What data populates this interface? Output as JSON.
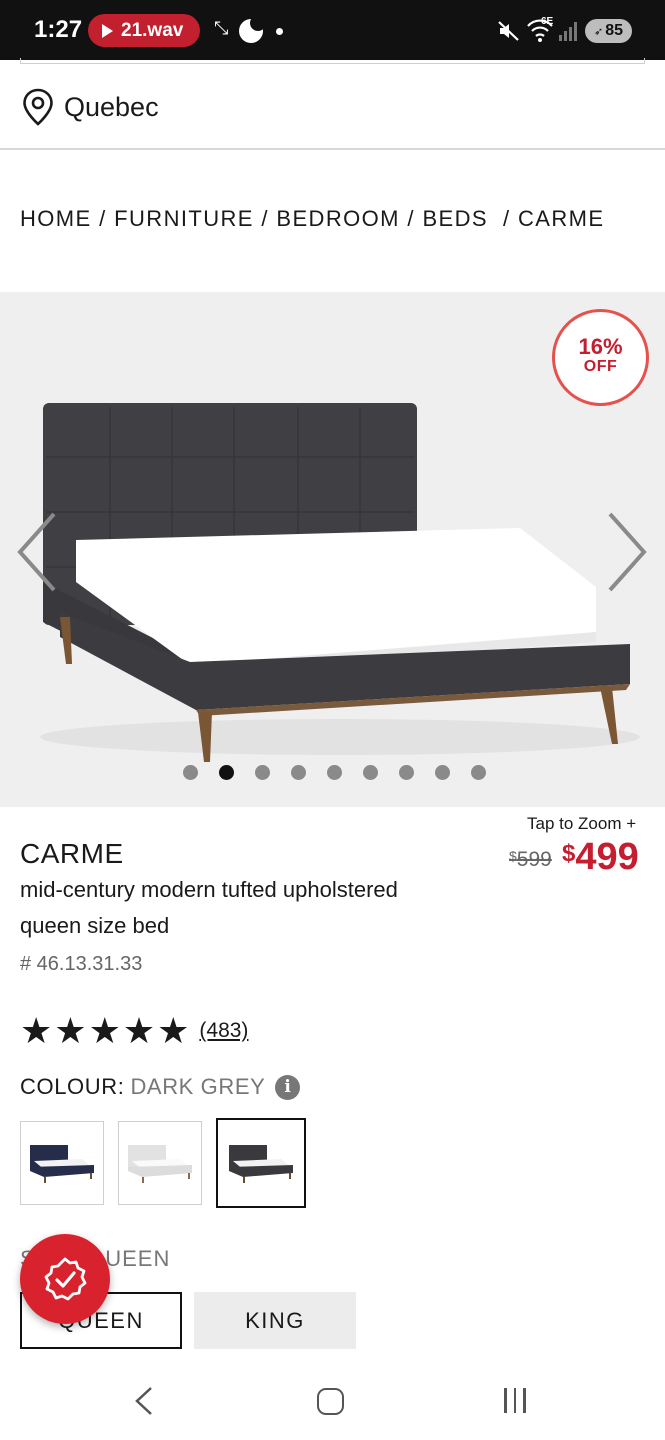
{
  "status_bar": {
    "time": "1:27",
    "recording_label": "21.wav",
    "network": "6E",
    "battery": "85"
  },
  "location": {
    "city": "Quebec",
    "icon": "location-pin-icon"
  },
  "breadcrumb": [
    "HOME",
    "FURNITURE",
    "BEDROOM",
    "BEDS ",
    "CARME"
  ],
  "gallery": {
    "discount_percent": "16%",
    "discount_label": "OFF",
    "slide_count": 9,
    "active_slide": 2,
    "zoom_label": "Tap to Zoom +"
  },
  "product": {
    "name": "CARME",
    "description": "mid-century modern tufted upholstered queen size bed",
    "sku": "# 46.13.31.33",
    "rating": 5,
    "review_count": "(483)",
    "old_price_symbol": "$",
    "old_price": "599",
    "new_price_symbol": "$",
    "new_price": "499"
  },
  "colour": {
    "label": "COLOUR:",
    "value": "DARK GREY",
    "options": [
      {
        "name": "navy",
        "frame": "#252d4a",
        "selected": false
      },
      {
        "name": "light grey",
        "frame": "#dedede",
        "selected": false
      },
      {
        "name": "dark grey",
        "frame": "#3a3a3e",
        "selected": true
      }
    ]
  },
  "size": {
    "label": "SIZE: QUEEN",
    "options": [
      {
        "label": "QUEEN",
        "selected": true
      },
      {
        "label": "KING",
        "selected": false
      }
    ]
  },
  "colors": {
    "accent": "#c41e30",
    "badge_border": "#e5514d",
    "fab": "#d8232f"
  }
}
